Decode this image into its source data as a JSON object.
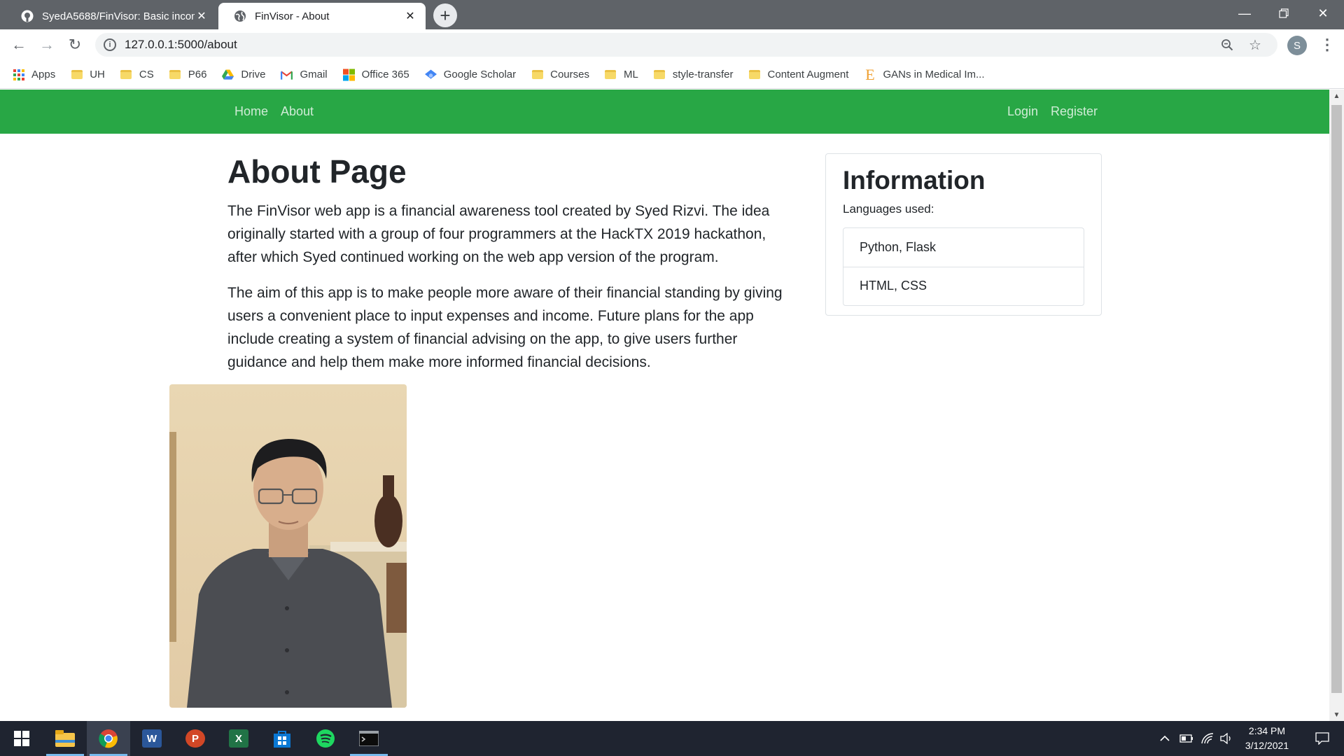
{
  "browser": {
    "tabs": [
      {
        "title": "SyedA5688/FinVisor: Basic incom",
        "favicon": "github-icon",
        "active": false
      },
      {
        "title": "FinVisor - About",
        "favicon": "globe-icon",
        "active": true
      }
    ],
    "address": "127.0.0.1:5000/about",
    "profile_initial": "S",
    "bookmarks": [
      {
        "label": "Apps",
        "icon": "apps-grid-icon"
      },
      {
        "label": "UH",
        "icon": "folder-icon"
      },
      {
        "label": "CS",
        "icon": "folder-icon"
      },
      {
        "label": "P66",
        "icon": "folder-icon"
      },
      {
        "label": "Drive",
        "icon": "google-drive-icon"
      },
      {
        "label": "Gmail",
        "icon": "gmail-icon"
      },
      {
        "label": "Office 365",
        "icon": "office-icon"
      },
      {
        "label": "Google Scholar",
        "icon": "scholar-icon"
      },
      {
        "label": "Courses",
        "icon": "folder-icon"
      },
      {
        "label": "ML",
        "icon": "folder-icon"
      },
      {
        "label": "style-transfer",
        "icon": "folder-icon"
      },
      {
        "label": "Content Augment",
        "icon": "folder-icon"
      },
      {
        "label": "GANs in Medical Im...",
        "icon": "e-logo-icon"
      }
    ]
  },
  "site": {
    "nav_left": [
      "Home",
      "About"
    ],
    "nav_right": [
      "Login",
      "Register"
    ],
    "brand_color": "#28a745"
  },
  "content": {
    "heading": "About Page",
    "paragraphs": [
      "The FinVisor web app is a financial awareness tool created by Syed Rizvi. The idea originally started with a group of four programmers at the HackTX 2019 hackathon, after which Syed continued working on the web app version of the program.",
      "The aim of this app is to make people more aware of their financial standing by giving users a convenient place to input expenses and income. Future plans for the app include creating a system of financial advising on the app, to give users further guidance and help them make more informed financial decisions."
    ]
  },
  "sidebar": {
    "title": "Information",
    "subtitle": "Languages used:",
    "items": [
      "Python, Flask",
      "HTML, CSS"
    ]
  },
  "taskbar": {
    "apps": [
      "file-explorer-icon",
      "chrome-icon",
      "word-icon",
      "powerpoint-icon",
      "excel-icon",
      "store-icon",
      "spotify-icon",
      "terminal-icon"
    ],
    "time": "2:34 PM",
    "date": "3/12/2021"
  }
}
